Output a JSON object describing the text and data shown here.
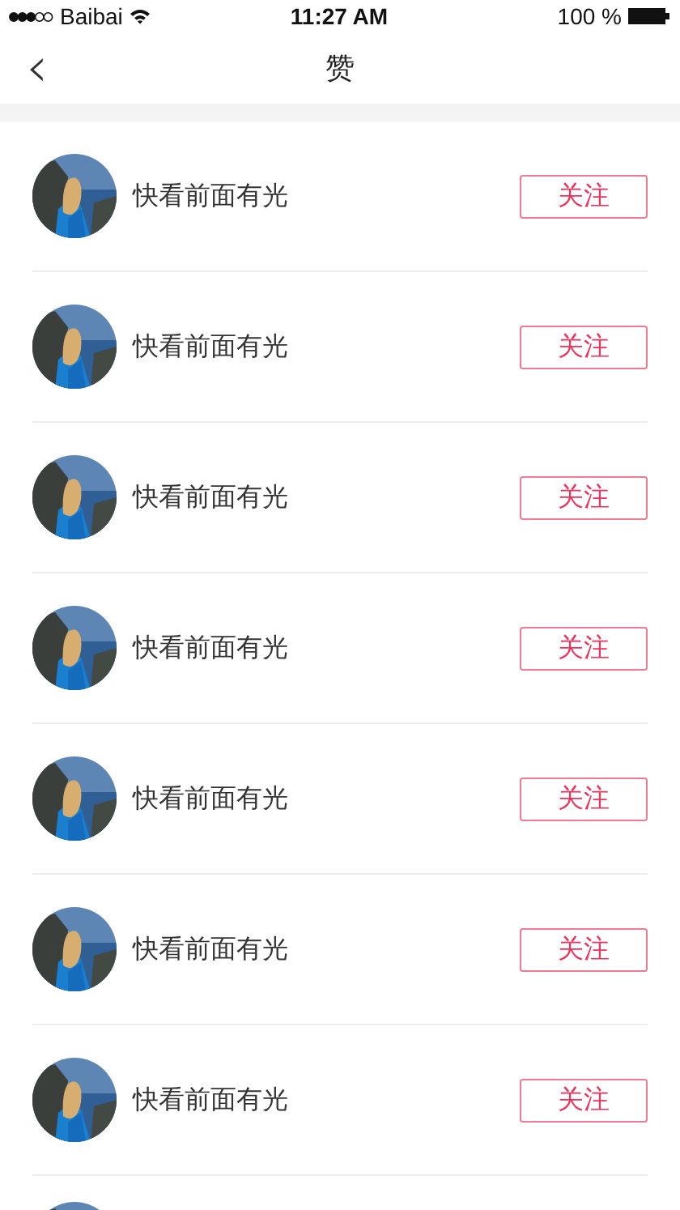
{
  "status_bar": {
    "carrier": "Baibai",
    "time": "11:27 AM",
    "battery": "100 %"
  },
  "nav": {
    "back": "‹",
    "title": "赞"
  },
  "rows": [
    {
      "kind": "user",
      "name": "快看前面有光",
      "button": "关注"
    },
    {
      "kind": "user",
      "name": "快看前面有光",
      "button": "关注"
    },
    {
      "kind": "user",
      "name": "快看前面有光",
      "button": "关注"
    },
    {
      "kind": "user",
      "name": "快看前面有光",
      "button": "关注"
    },
    {
      "kind": "user",
      "name": "快看前面有光",
      "button": "关注"
    },
    {
      "kind": "user",
      "name": "快看前面有光",
      "button": "关注"
    },
    {
      "kind": "user",
      "name": "快看前面有光",
      "button": "关注"
    },
    {
      "kind": "partial"
    }
  ]
}
